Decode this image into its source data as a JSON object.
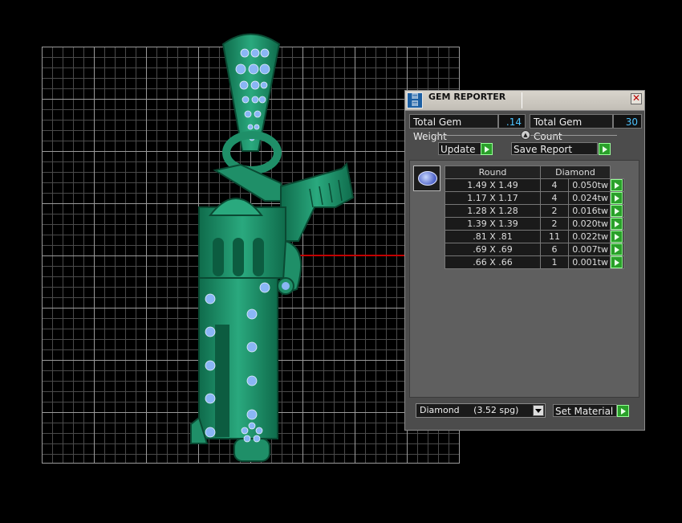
{
  "panel": {
    "title": "GEM REPORTER",
    "total_weight_label": "Total Gem Weight",
    "total_weight_value": ".14",
    "total_count_label": "Total Gem Count",
    "total_count_value": "30",
    "update_label": "Update",
    "save_report_label": "Save Report",
    "table": {
      "headers": [
        "Round",
        "Diamond"
      ],
      "rows": [
        {
          "size": "1.49 X 1.49",
          "count": "4",
          "weight": "0.050tw"
        },
        {
          "size": "1.17 X 1.17",
          "count": "4",
          "weight": "0.024tw"
        },
        {
          "size": "1.28 X 1.28",
          "count": "2",
          "weight": "0.016tw"
        },
        {
          "size": "1.39 X 1.39",
          "count": "2",
          "weight": "0.020tw"
        },
        {
          "size": ".81 X .81",
          "count": "11",
          "weight": "0.022tw"
        },
        {
          "size": ".69 X .69",
          "count": "6",
          "weight": "0.007tw"
        },
        {
          "size": ".66 X .66",
          "count": "1",
          "weight": "0.001tw"
        }
      ]
    },
    "material_selected": "Diamond     (3.52 spg)",
    "set_material_label": "Set Material"
  },
  "colors": {
    "model_green": "#1f8f68",
    "gem_blue": "#7fb0f0",
    "accent_blue": "#4dc3ff",
    "go_green": "#2aa02a"
  }
}
